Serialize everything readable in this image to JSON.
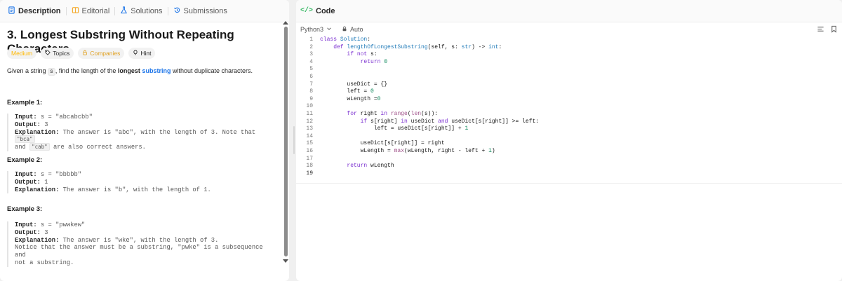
{
  "left_tabs": [
    {
      "label": "Description",
      "icon": "document-icon",
      "active": true
    },
    {
      "label": "Editorial",
      "icon": "book-icon",
      "active": false
    },
    {
      "label": "Solutions",
      "icon": "flask-icon",
      "active": false
    },
    {
      "label": "Submissions",
      "icon": "history-icon",
      "active": false
    }
  ],
  "problem": {
    "title": "3. Longest Substring Without Repeating Characters",
    "tags": {
      "difficulty": "Medium",
      "topics": "Topics",
      "companies": "Companies",
      "hint": "Hint"
    },
    "desc": {
      "p1": "Given a string ",
      "var": "s",
      "p2": ", find the length of the ",
      "bold": "longest",
      "link": "substring",
      "p3": " without duplicate characters."
    },
    "examples": [
      {
        "title": "Example 1:",
        "input_label": "Input:",
        "input": "s = \"abcabcbb\"",
        "output_label": "Output:",
        "output": "3",
        "expl_label": "Explanation:",
        "expl_a": "The answer is \"abc\", with the length of 3. Note that",
        "code1": "\"bca\"",
        "expl_b": "and",
        "code2": "\"cab\"",
        "expl_c": "are also correct answers."
      },
      {
        "title": "Example 2:",
        "input_label": "Input:",
        "input": "s = \"bbbbb\"",
        "output_label": "Output:",
        "output": "1",
        "expl_label": "Explanation:",
        "expl_a": "The answer is \"b\", with the length of 1."
      },
      {
        "title": "Example 3:",
        "input_label": "Input:",
        "input": "s = \"pwwkew\"",
        "output_label": "Output:",
        "output": "3",
        "expl_label": "Explanation:",
        "expl_a": "The answer is \"wke\", with the length of 3.",
        "expl_b": "Notice that the answer must be a substring, \"pwke\" is a subsequence and",
        "expl_c": "not a substring."
      }
    ]
  },
  "code_panel": {
    "title_icon": "</>",
    "title": "Code",
    "language": "Python3",
    "mode": "Auto"
  },
  "code_lines": [
    "class Solution:",
    "    def lengthOfLongestSubstring(self, s: str) -> int:",
    "        if not s:",
    "            return 0",
    "",
    "",
    "        useDict = {}",
    "        left = 0",
    "        wLength =0",
    "",
    "        for right in range(len(s)):",
    "            if s[right] in useDict and useDict[s[right]] >= left:",
    "                left = useDict[s[right]] + 1",
    "",
    "            useDict[s[right]] = right",
    "            wLength = max(wLength, right - left + 1)",
    "",
    "        return wLength",
    ""
  ],
  "line_numbers": [
    "1",
    "2",
    "3",
    "4",
    "5",
    "6",
    "7",
    "8",
    "9",
    "10",
    "11",
    "12",
    "13",
    "14",
    "15",
    "16",
    "17",
    "18",
    "19"
  ]
}
